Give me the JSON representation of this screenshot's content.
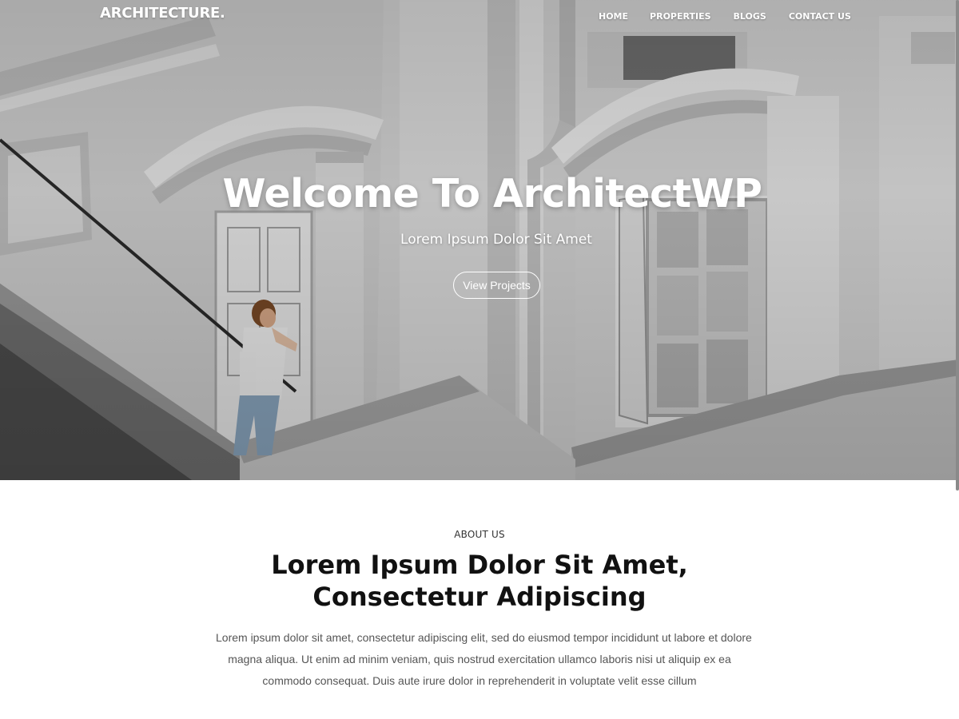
{
  "header": {
    "logo": "ARCHITECTURE.",
    "nav": [
      "HOME",
      "PROPERTIES",
      "BLOGS",
      "CONTACT US"
    ]
  },
  "hero": {
    "title": "Welcome To ArchitectWP",
    "subtitle": "Lorem Ipsum Dolor Sit Amet",
    "button_label": "View Projects"
  },
  "about": {
    "eyebrow": "ABOUT US",
    "title_line1": "Lorem Ipsum Dolor Sit Amet,",
    "title_line2": "Consectetur Adipiscing",
    "body_line1": "Lorem ipsum dolor sit amet, consectetur adipiscing elit, sed do eiusmod tempor incididunt ut labore et dolore",
    "body_line2": "magna aliqua. Ut enim ad minim veniam, quis nostrud exercitation ullamco laboris nisi ut aliquip ex ea",
    "body_line3": "commodo consequat. Duis aute irure dolor in reprehenderit in voluptate velit esse cillum"
  },
  "colors": {
    "text_dark": "#111111",
    "body_text": "#555555",
    "hero_text": "#ffffff"
  }
}
